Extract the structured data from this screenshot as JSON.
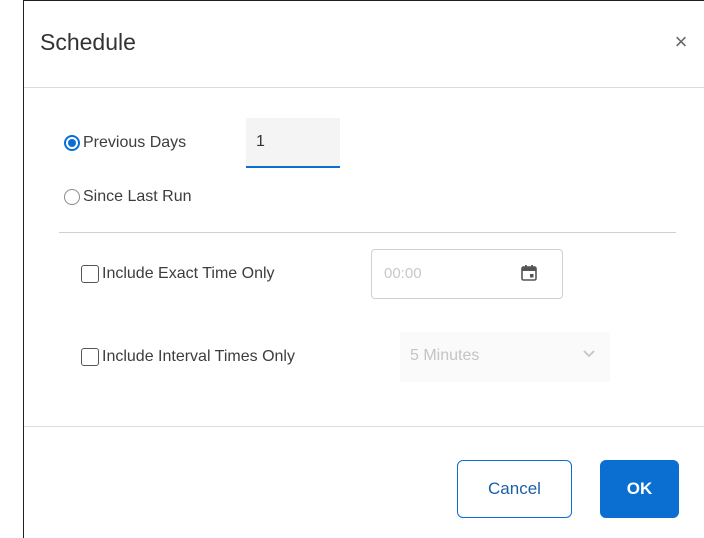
{
  "dialog": {
    "title": "Schedule",
    "close_icon": "close-icon",
    "close_glyph": "×"
  },
  "options": {
    "previous_days": {
      "label": "Previous Days",
      "checked": true,
      "value": "1"
    },
    "since_last_run": {
      "label": "Since Last Run",
      "checked": false
    }
  },
  "filters": {
    "exact_time": {
      "label": "Include Exact Time Only",
      "checked": false,
      "placeholder": "00:00",
      "icon": "calendar-icon"
    },
    "interval_times": {
      "label": "Include Interval Times Only",
      "checked": false,
      "selected": "5 Minutes",
      "icon": "chevron-down-icon"
    }
  },
  "buttons": {
    "cancel": "Cancel",
    "ok": "OK"
  },
  "colors": {
    "accent": "#0a6fd1",
    "disabled_text": "#c4c4c4"
  }
}
